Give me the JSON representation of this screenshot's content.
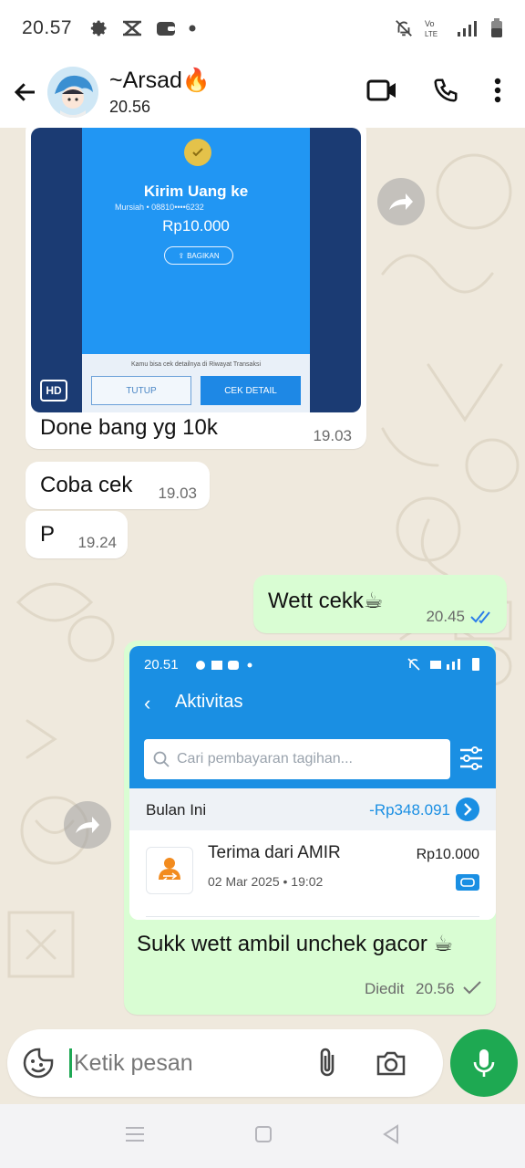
{
  "status_bar": {
    "time": "20.57",
    "network_label_top": "Vo",
    "network_label_bottom": "LTE"
  },
  "header": {
    "contact_name": "~Arsad🔥",
    "contact_status": "20.56"
  },
  "messages": [
    {
      "direction": "incoming",
      "type": "image",
      "image": {
        "title": "Kirim Uang ke",
        "recipient": "Mursiah • 08810••••6232",
        "amount": "Rp10.000",
        "share_label": "BAGIKAN",
        "note": "Kamu bisa cek detailnya di Riwayat Transaksi",
        "button_close": "TUTUP",
        "button_detail": "CEK DETAIL",
        "hd_badge": "HD"
      },
      "text": "Done bang yg 10k",
      "time": "19.03"
    },
    {
      "direction": "incoming",
      "type": "text",
      "text": "Coba cek",
      "time": "19.03"
    },
    {
      "direction": "incoming",
      "type": "text",
      "text": "P",
      "time": "19.24"
    },
    {
      "direction": "outgoing",
      "type": "text",
      "text": "Wett cekk☕",
      "time": "20.45",
      "read": true
    },
    {
      "direction": "outgoing",
      "type": "image",
      "image": {
        "time": "20.51",
        "title": "Aktivitas",
        "search_placeholder": "Cari pembayaran tagihan...",
        "month_label": "Bulan Ini",
        "month_amount": "-Rp348.091",
        "row_title": "Terima dari AMIR",
        "row_date": "02 Mar 2025 • 19:02",
        "row_amount": "Rp10.000"
      },
      "text": "Sukk wett ambil unchek gacor ☕",
      "edited_label": "Diedit",
      "time": "20.56",
      "read": false
    }
  ],
  "composer": {
    "placeholder": "Ketik pesan"
  },
  "colors": {
    "accent_green": "#1ea952",
    "outgoing_bubble": "#d9fdd3",
    "read_tick": "#2b7de9",
    "wallpaper": "#efe9dd",
    "dana_blue": "#1a8fe3"
  }
}
